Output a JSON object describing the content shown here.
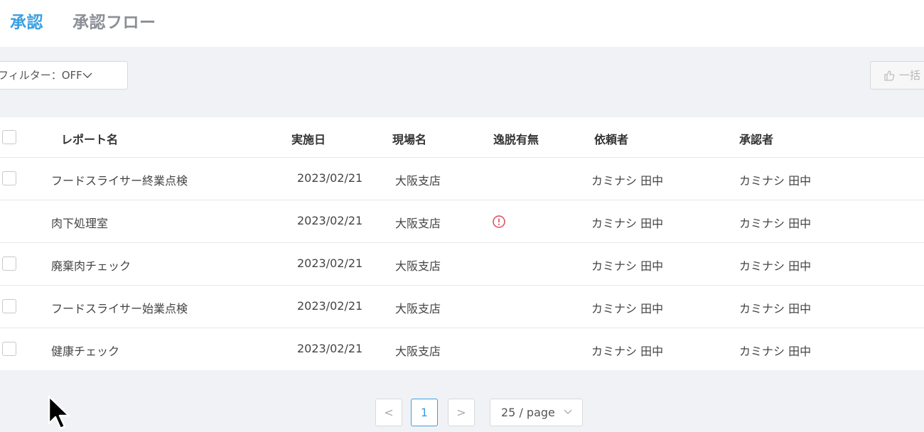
{
  "tabs": [
    {
      "label": "承認",
      "active": true
    },
    {
      "label": "承認フロー",
      "active": false
    }
  ],
  "toolbar": {
    "filter_label": "フィルター：OFF",
    "bulk_label": "一括"
  },
  "table": {
    "headers": {
      "report_name": "レポート名",
      "date": "実施日",
      "site": "現場名",
      "deviation": "逸脱有無",
      "requester": "依頼者",
      "approver": "承認者"
    },
    "rows": [
      {
        "report_name": "フードスライサー終業点検",
        "date": "2023/02/21",
        "site": "大阪支店",
        "deviation": false,
        "requester": "カミナシ 田中",
        "approver": "カミナシ 田中",
        "has_checkbox": true
      },
      {
        "report_name": "肉下処理室",
        "date": "2023/02/21",
        "site": "大阪支店",
        "deviation": true,
        "requester": "カミナシ 田中",
        "approver": "カミナシ 田中",
        "has_checkbox": false
      },
      {
        "report_name": "廃棄肉チェック",
        "date": "2023/02/21",
        "site": "大阪支店",
        "deviation": false,
        "requester": "カミナシ 田中",
        "approver": "カミナシ 田中",
        "has_checkbox": true
      },
      {
        "report_name": "フードスライサー始業点検",
        "date": "2023/02/21",
        "site": "大阪支店",
        "deviation": false,
        "requester": "カミナシ 田中",
        "approver": "カミナシ 田中",
        "has_checkbox": true
      },
      {
        "report_name": "健康チェック",
        "date": "2023/02/21",
        "site": "大阪支店",
        "deviation": false,
        "requester": "カミナシ 田中",
        "approver": "カミナシ 田中",
        "has_checkbox": true
      }
    ]
  },
  "pagination": {
    "prev": "<",
    "current_page": "1",
    "next": ">",
    "page_size": "25 / page"
  },
  "colors": {
    "accent": "#3aa0e0",
    "alert": "#e0475b"
  }
}
